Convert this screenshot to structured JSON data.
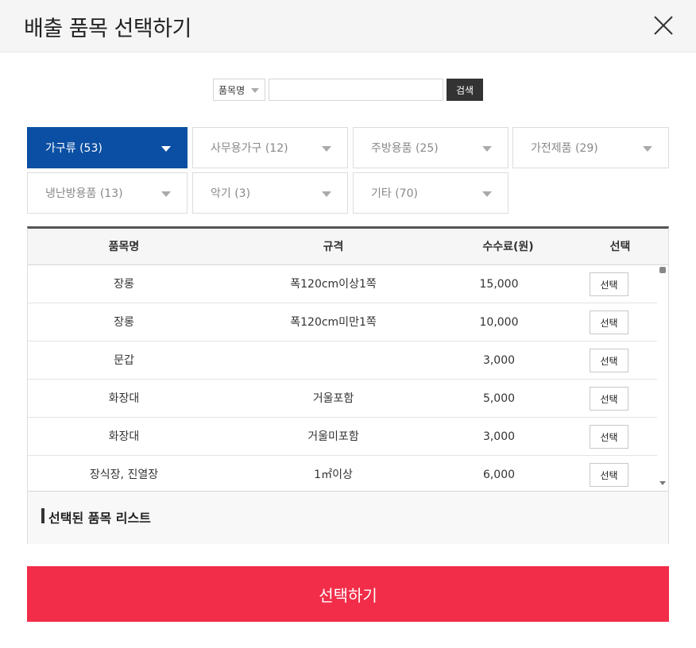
{
  "header": {
    "title": "배출 품목 선택하기"
  },
  "search": {
    "select_value": "품목명",
    "input_value": "",
    "button_label": "검색"
  },
  "categories": [
    {
      "label": "가구류 (53)",
      "active": true
    },
    {
      "label": "사무용가구 (12)",
      "active": false
    },
    {
      "label": "주방용품 (25)",
      "active": false
    },
    {
      "label": "가전제품 (29)",
      "active": false
    },
    {
      "label": "냉난방용품 (13)",
      "active": false
    },
    {
      "label": "악기 (3)",
      "active": false
    },
    {
      "label": "기타 (70)",
      "active": false
    }
  ],
  "table": {
    "headers": [
      "품목명",
      "규격",
      "수수료(원)",
      "선택"
    ],
    "rows": [
      {
        "name": "장롱",
        "spec": "폭120cm이상1쪽",
        "fee": "15,000",
        "action": "선택"
      },
      {
        "name": "장롱",
        "spec": "폭120cm미만1쪽",
        "fee": "10,000",
        "action": "선택"
      },
      {
        "name": "문갑",
        "spec": "",
        "fee": "3,000",
        "action": "선택"
      },
      {
        "name": "화장대",
        "spec": "거울포함",
        "fee": "5,000",
        "action": "선택"
      },
      {
        "name": "화장대",
        "spec": "거울미포함",
        "fee": "3,000",
        "action": "선택"
      },
      {
        "name": "장식장, 진열장",
        "spec": "1㎡이상",
        "fee": "6,000",
        "action": "선택"
      }
    ]
  },
  "selected_list": {
    "label": "선택된 품목 리스트"
  },
  "submit": {
    "label": "선택하기"
  },
  "colors": {
    "accent": "#0a4fa3",
    "submit": "#f12d4a",
    "header_bg": "#f5f5f5"
  }
}
